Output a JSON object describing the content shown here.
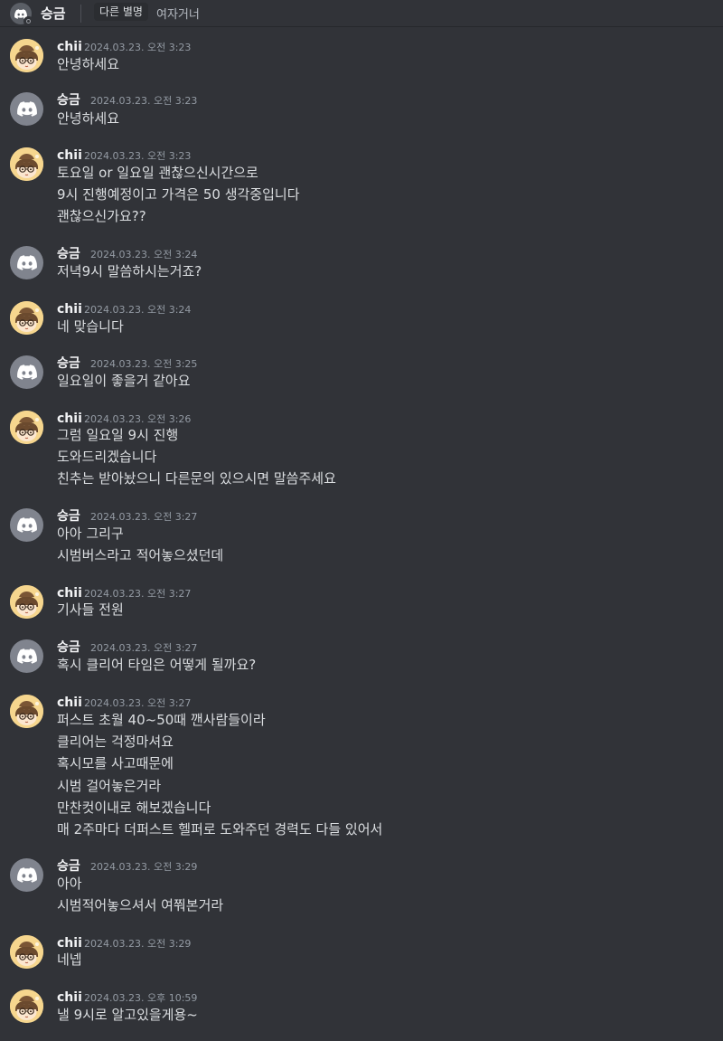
{
  "header": {
    "title": "승금",
    "tag": "다른 별명",
    "subtitle": "여자거너"
  },
  "messages": [
    {
      "author": "chii",
      "avatar": "chii",
      "time": "2024.03.23. 오전 3:23",
      "lines": [
        "안녕하세요"
      ]
    },
    {
      "author": "승금",
      "avatar": "discord",
      "time": "2024.03.23. 오전 3:23",
      "lines": [
        "안녕하세요"
      ]
    },
    {
      "author": "chii",
      "avatar": "chii",
      "time": "2024.03.23. 오전 3:23",
      "lines": [
        "토요일 or 일요일 괜찮으신시간으로",
        "9시 진행예정이고 가격은 50 생각중입니다",
        "괜찮으신가요??"
      ]
    },
    {
      "author": "승금",
      "avatar": "discord",
      "time": "2024.03.23. 오전 3:24",
      "lines": [
        "저녁9시 말씀하시는거죠?"
      ]
    },
    {
      "author": "chii",
      "avatar": "chii",
      "time": "2024.03.23. 오전 3:24",
      "lines": [
        "네 맞습니다"
      ]
    },
    {
      "author": "승금",
      "avatar": "discord",
      "time": "2024.03.23. 오전 3:25",
      "lines": [
        "일요일이 좋을거 같아요"
      ]
    },
    {
      "author": "chii",
      "avatar": "chii",
      "time": "2024.03.23. 오전 3:26",
      "lines": [
        "그럼 일요일 9시 진행",
        "도와드리겠습니다",
        "친추는 받아놨으니 다른문의 있으시면 말씀주세요"
      ]
    },
    {
      "author": "승금",
      "avatar": "discord",
      "time": "2024.03.23. 오전 3:27",
      "lines": [
        "아아 그리구",
        "시범버스라고 적어놓으셨던데"
      ]
    },
    {
      "author": "chii",
      "avatar": "chii",
      "time": "2024.03.23. 오전 3:27",
      "lines": [
        "기사들 전원"
      ]
    },
    {
      "author": "승금",
      "avatar": "discord",
      "time": "2024.03.23. 오전 3:27",
      "lines": [
        "혹시 클리어 타임은 어떻게 될까요?"
      ]
    },
    {
      "author": "chii",
      "avatar": "chii",
      "time": "2024.03.23. 오전 3:27",
      "lines": [
        "퍼스트 초월 40~50때 깬사람들이라",
        "클리어는 걱정마셔요",
        "혹시모를 사고때문에",
        "시범 걸어놓은거라",
        "만찬컷이내로 해보겠습니다",
        "매 2주마다 더퍼스트 헬퍼로 도와주던 경력도 다들 있어서"
      ]
    },
    {
      "author": "승금",
      "avatar": "discord",
      "time": "2024.03.23. 오전 3:29",
      "lines": [
        "아아",
        "시범적어놓으셔서 여쭤본거라"
      ]
    },
    {
      "author": "chii",
      "avatar": "chii",
      "time": "2024.03.23. 오전 3:29",
      "lines": [
        "네넵"
      ]
    },
    {
      "author": "chii",
      "avatar": "chii",
      "time": "2024.03.23. 오후 10:59",
      "lines": [
        "낼 9시로 알고있을게용~"
      ]
    }
  ],
  "colors": {
    "background": "#313338",
    "text": "#dbdee1",
    "username": "#f2f3f5",
    "timestamp": "#949ba4",
    "discord_avatar": "#80848e",
    "chii_avatar": "#f3d58d"
  },
  "icons": {
    "discord": "discord-logo-icon",
    "chii": "chii-avatar-icon"
  }
}
